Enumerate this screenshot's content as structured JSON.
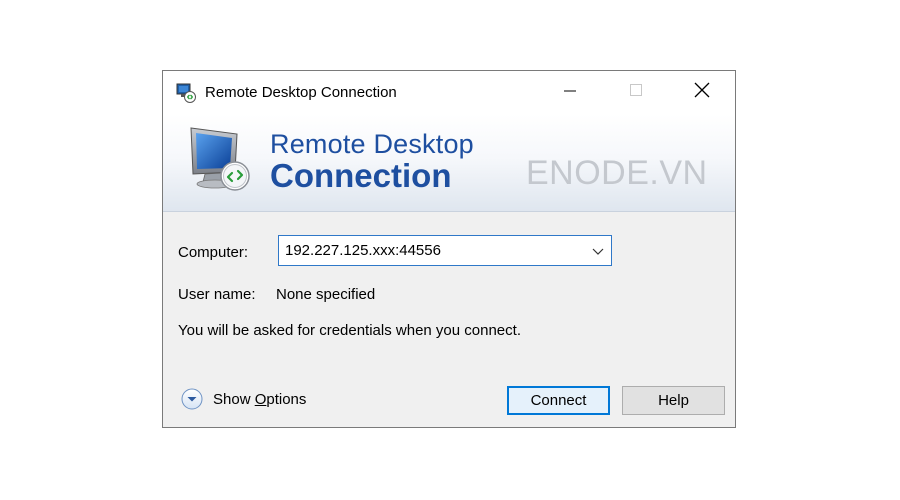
{
  "window": {
    "title": "Remote Desktop Connection",
    "controls": {
      "minimize": "—",
      "maximize": "☐",
      "close": "✕"
    }
  },
  "banner": {
    "title_line1": "Remote Desktop",
    "title_line2": "Connection",
    "watermark": "ENODE.VN",
    "icon": "rdp-monitor-icon"
  },
  "form": {
    "computer_label": "Computer:",
    "computer_value": "192.227.125.xxx:44556",
    "username_label": "User name:",
    "username_value": "None specified",
    "info_text": "You will be asked for credentials when you connect."
  },
  "footer": {
    "show_options_prefix": "Show ",
    "show_options_accel": "O",
    "show_options_suffix": "ptions",
    "connect_label": "Connect",
    "help_label": "Help"
  },
  "colors": {
    "accent": "#0078d7",
    "banner_title": "#1e4fa0",
    "watermark": "#c4c8ce"
  }
}
